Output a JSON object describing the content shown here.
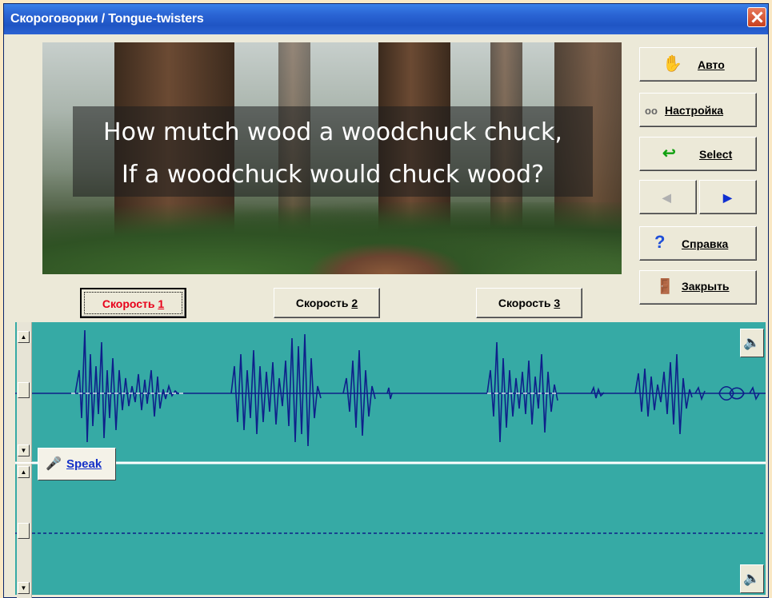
{
  "window": {
    "title": "Скороговорки / Tongue-twisters"
  },
  "phrase": {
    "line1": "How mutch wood a woodchuck chuck,",
    "line2": "If a woodchuck would chuck wood?"
  },
  "side_buttons": {
    "auto": "Авто",
    "settings": "Настройка",
    "select": "Select",
    "help": "Справка",
    "close": "Закрыть"
  },
  "speed_buttons": [
    {
      "prefix": "Скорость ",
      "num": "1",
      "active": true
    },
    {
      "prefix": "Скорость ",
      "num": "2",
      "active": false
    },
    {
      "prefix": "Скорость ",
      "num": "3",
      "active": false
    }
  ],
  "speak_button": {
    "label": "Speak"
  },
  "colors": {
    "wave_bg": "#36aaa5",
    "wave_line": "#0e1f8a",
    "active_speed": "#e8001a",
    "title_bar": "#2a64d4"
  },
  "icons": {
    "auto": "hand-icon",
    "settings": "glasses-icon",
    "select": "arrow-return-icon",
    "prev": "triangle-left-icon",
    "next": "triangle-right-icon",
    "help": "question-icon",
    "close": "door-exit-icon",
    "speaker": "speaker-icon",
    "mic": "microphone-icon"
  }
}
